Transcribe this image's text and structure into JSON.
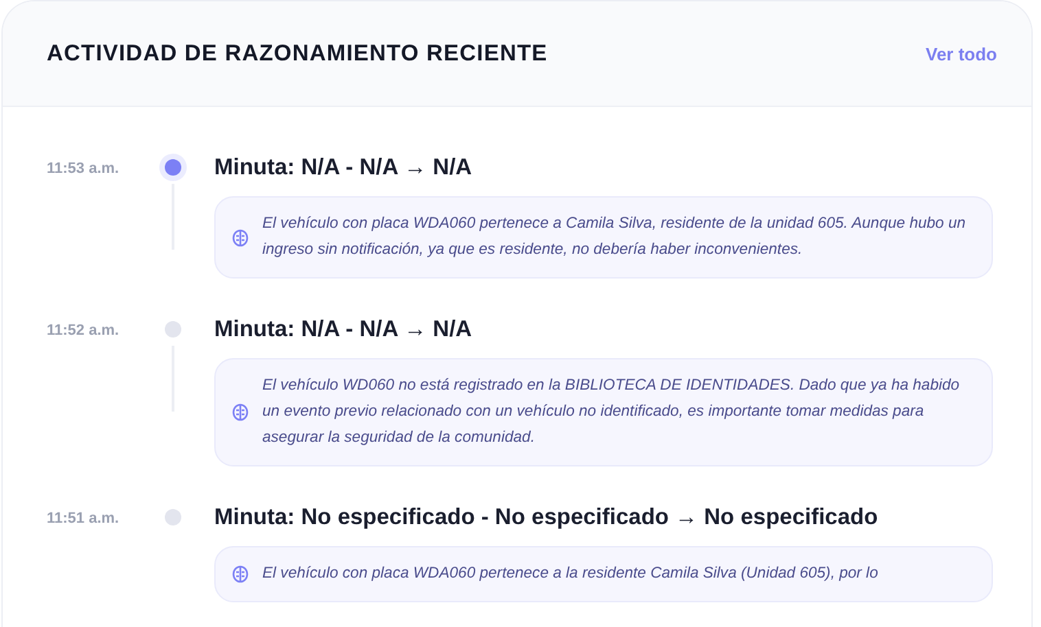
{
  "panel": {
    "title": "ACTIVIDAD DE RAZONAMIENTO RECIENTE",
    "link": "Ver todo"
  },
  "events": [
    {
      "time": "11:53 a.m.",
      "selected": true,
      "title": "Minuta: N/A - N/A → N/A",
      "reasoning": "El vehículo con placa WDA060 pertenece a Camila Silva, residente de la unidad 605. Aunque hubo un ingreso sin notificación, ya que es residente, no debería haber inconvenientes."
    },
    {
      "time": "11:52 a.m.",
      "selected": false,
      "title": "Minuta: N/A - N/A → N/A",
      "reasoning": "El vehículo WD060 no está registrado en la BIBLIOTECA DE IDENTIDADES. Dado que ya ha habido un evento previo relacionado con un vehículo no identificado, es importante tomar medidas para asegurar la seguridad de la comunidad."
    },
    {
      "time": "11:51 a.m.",
      "selected": false,
      "title": "Minuta: No especificado - No especificado → No especificado",
      "reasoning": "El vehículo con placa WDA060 pertenece a la residente Camila Silva (Unidad 605), por lo"
    }
  ]
}
